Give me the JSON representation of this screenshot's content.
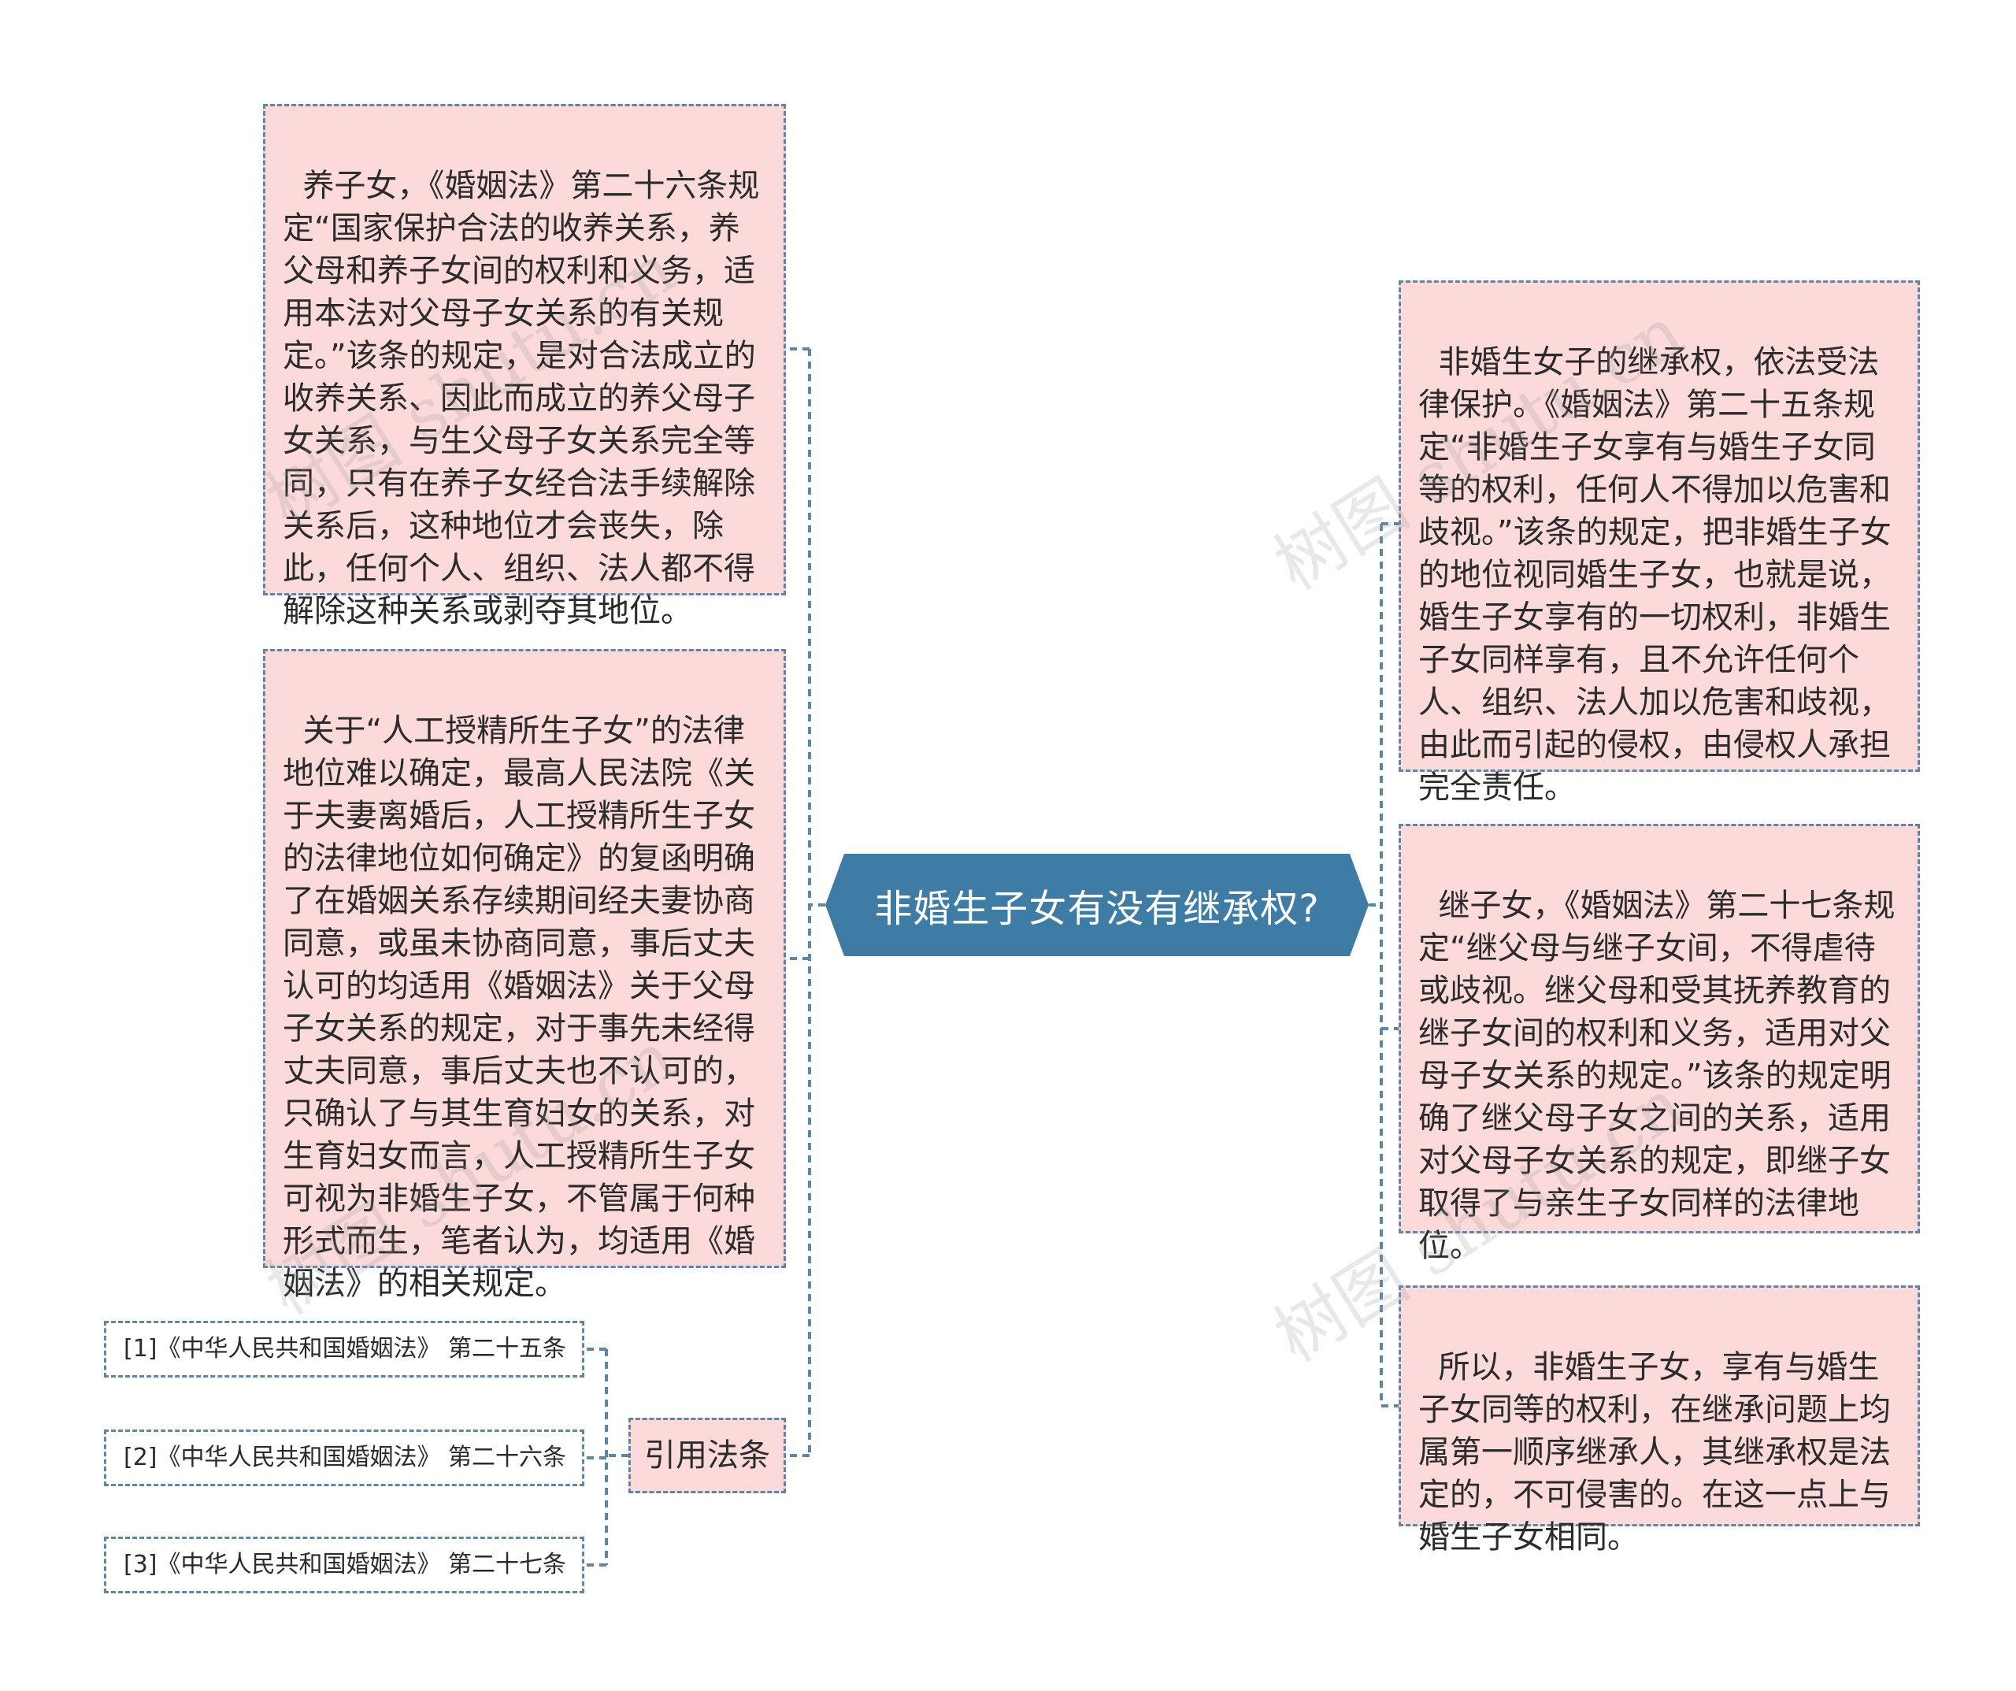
{
  "center": {
    "label": "非婚生子女有没有继承权?"
  },
  "left_nodes": [
    {
      "text": "养子女，《婚姻法》第二十六条规定“国家保护合法的收养关系，养父母和养子女间的权利和义务，适用本法对父母子女关系的有关规定。”该条的规定，是对合法成立的收养关系、因此而成立的养父母子女关系，与生父母子女关系完全等同，只有在养子女经合法手续解除关系后，这种地位才会丧失，除此，任何个人、组织、法人都不得解除这种关系或剥夺其地位。"
    },
    {
      "text": "关于“人工授精所生子女”的法律地位难以确定，最高人民法院《关于夫妻离婚后，人工授精所生子女的法律地位如何确定》的复函明确了在婚姻关系存续期间经夫妻协商同意，或虽未协商同意，事后丈夫认可的均适用《婚姻法》关于父母子女关系的规定，对于事先未经得丈夫同意，事后丈夫也不认可的，只确认了与其生育妇女的关系，对生育妇女而言，人工授精所生子女可视为非婚生子女，不管属于何种形式而生，笔者认为，均适用《婚姻法》的相关规定。"
    }
  ],
  "citation": {
    "label": "引用法条",
    "refs": [
      "[1]《中华人民共和国婚姻法》 第二十五条",
      "[2]《中华人民共和国婚姻法》 第二十六条",
      "[3]《中华人民共和国婚姻法》 第二十七条"
    ]
  },
  "right_nodes": [
    {
      "text": "非婚生女子的继承权，依法受法律保护。《婚姻法》第二十五条规定“非婚生子女享有与婚生子女同等的权利，任何人不得加以危害和歧视。”该条的规定，把非婚生子女的地位视同婚生子女，也就是说，婚生子女享有的一切权利，非婚生子女同样享有，且不允许任何个人、组织、法人加以危害和歧视，由此而引起的侵权，由侵权人承担完全责任。"
    },
    {
      "text": "继子女，《婚姻法》第二十七条规定“继父母与继子女间，不得虐待或歧视。继父母和受其抚养教育的继子女间的权利和义务，适用对父母子女关系的规定。”该条的规定明确了继父母子女之间的关系，适用对父母子女关系的规定，即继子女取得了与亲生子女同样的法律地位。"
    },
    {
      "text": "所以，非婚生子女，享有与婚生子女同等的权利，在继承问题上均属第一顺序继承人，其继承权是法定的，不可侵害的。在这一点上与婚生子女相同。"
    }
  ],
  "watermarks": [
    "树图 shutu.cn",
    "树图 shutu.cn",
    "树图 shutu.cn",
    "树图 shutu.cn"
  ],
  "colors": {
    "center_fill": "#3e7ca6",
    "node_fill": "#fcdada",
    "connector": "#5f86a6"
  }
}
